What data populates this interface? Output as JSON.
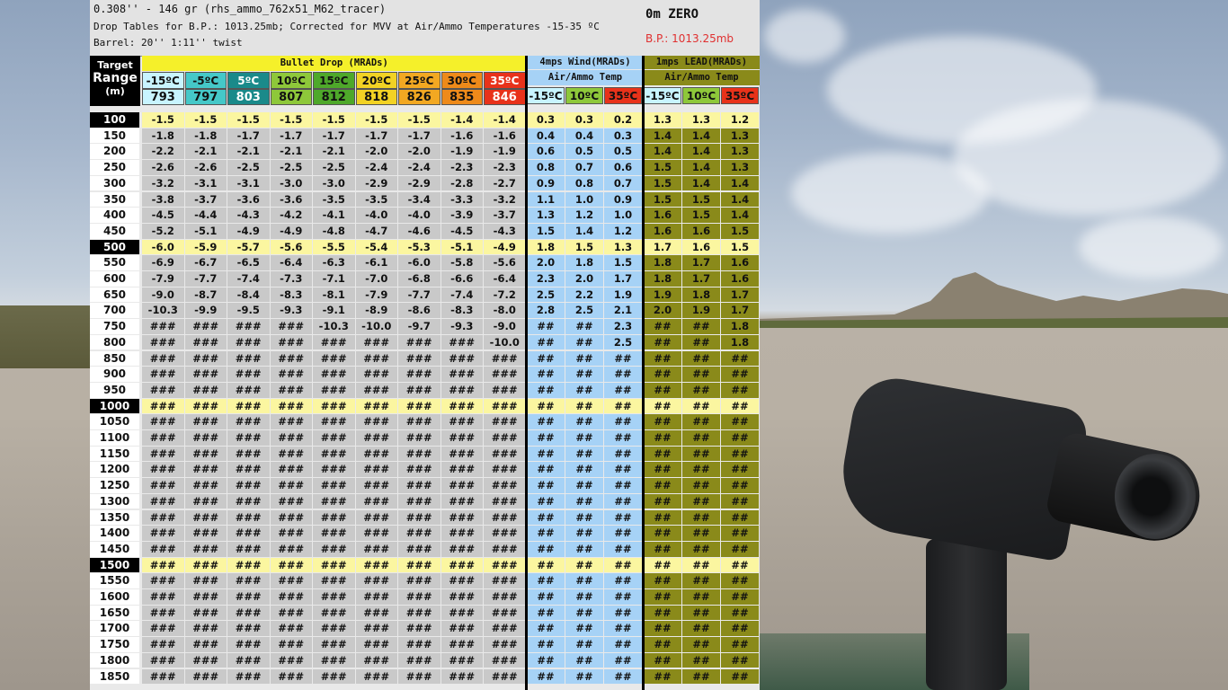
{
  "header": {
    "ammo_line": "0.308'' - 146 gr (rhs_ammo_762x51_M62_tracer)",
    "table_line": "Drop Tables for B.P.: 1013.25mb; Corrected for MVV at Air/Ammo Temperatures -15-35 ºC",
    "barrel_line": "Barrel: 20'' 1:11'' twist",
    "zero": "0m ZERO",
    "bp": "B.P.: 1013.25mb"
  },
  "target_header": {
    "line1": "Target",
    "line2": "Range",
    "line3": "(m)"
  },
  "drop_title": "Bullet Drop (MRADs)",
  "wind_title": "4mps Wind(MRADs)",
  "wind_sub": "Air/Ammo Temp",
  "lead_title": "1mps LEAD(MRADs)",
  "lead_sub": "Air/Ammo Temp",
  "temps": [
    {
      "t": "-15ºC",
      "v": "793",
      "bg": "#c8f4ff"
    },
    {
      "t": "-5ºC",
      "v": "797",
      "bg": "#45c8c8"
    },
    {
      "t": "5ºC",
      "v": "803",
      "bg": "#1a8a8a"
    },
    {
      "t": "10ºC",
      "v": "807",
      "bg": "#8ec83a"
    },
    {
      "t": "15ºC",
      "v": "812",
      "bg": "#4ea82a"
    },
    {
      "t": "20ºC",
      "v": "818",
      "bg": "#f2d224"
    },
    {
      "t": "25ºC",
      "v": "826",
      "bg": "#f2a822"
    },
    {
      "t": "30ºC",
      "v": "835",
      "bg": "#ee8a1a"
    },
    {
      "t": "35ºC",
      "v": "846",
      "bg": "#e8321a"
    }
  ],
  "sub_temps": [
    {
      "t": "-15ºC",
      "bg": "#c8f4ff"
    },
    {
      "t": "10ºC",
      "bg": "#8ec83a"
    },
    {
      "t": "35ºC",
      "bg": "#e8321a"
    }
  ],
  "colors": {
    "drop_cell": "#c9c9c9",
    "wind_cell": "#a6d2f6",
    "lead_cell": "#8a8a1a",
    "highlight_row": "#fbf6a0",
    "title_bar": "#f5f02a"
  },
  "rows": [
    {
      "r": "100",
      "hl": true,
      "d": [
        "-1.5",
        "-1.5",
        "-1.5",
        "-1.5",
        "-1.5",
        "-1.5",
        "-1.5",
        "-1.4",
        "-1.4"
      ],
      "w": [
        "0.3",
        "0.3",
        "0.2"
      ],
      "l": [
        "1.3",
        "1.3",
        "1.2"
      ]
    },
    {
      "r": "150",
      "d": [
        "-1.8",
        "-1.8",
        "-1.7",
        "-1.7",
        "-1.7",
        "-1.7",
        "-1.7",
        "-1.6",
        "-1.6"
      ],
      "w": [
        "0.4",
        "0.4",
        "0.3"
      ],
      "l": [
        "1.4",
        "1.4",
        "1.3"
      ]
    },
    {
      "r": "200",
      "d": [
        "-2.2",
        "-2.1",
        "-2.1",
        "-2.1",
        "-2.1",
        "-2.0",
        "-2.0",
        "-1.9",
        "-1.9"
      ],
      "w": [
        "0.6",
        "0.5",
        "0.5"
      ],
      "l": [
        "1.4",
        "1.4",
        "1.3"
      ]
    },
    {
      "r": "250",
      "d": [
        "-2.6",
        "-2.6",
        "-2.5",
        "-2.5",
        "-2.5",
        "-2.4",
        "-2.4",
        "-2.3",
        "-2.3"
      ],
      "w": [
        "0.8",
        "0.7",
        "0.6"
      ],
      "l": [
        "1.5",
        "1.4",
        "1.3"
      ]
    },
    {
      "r": "300",
      "d": [
        "-3.2",
        "-3.1",
        "-3.1",
        "-3.0",
        "-3.0",
        "-2.9",
        "-2.9",
        "-2.8",
        "-2.7"
      ],
      "w": [
        "0.9",
        "0.8",
        "0.7"
      ],
      "l": [
        "1.5",
        "1.4",
        "1.4"
      ]
    },
    {
      "r": "350",
      "d": [
        "-3.8",
        "-3.7",
        "-3.6",
        "-3.6",
        "-3.5",
        "-3.5",
        "-3.4",
        "-3.3",
        "-3.2"
      ],
      "w": [
        "1.1",
        "1.0",
        "0.9"
      ],
      "l": [
        "1.5",
        "1.5",
        "1.4"
      ]
    },
    {
      "r": "400",
      "d": [
        "-4.5",
        "-4.4",
        "-4.3",
        "-4.2",
        "-4.1",
        "-4.0",
        "-4.0",
        "-3.9",
        "-3.7"
      ],
      "w": [
        "1.3",
        "1.2",
        "1.0"
      ],
      "l": [
        "1.6",
        "1.5",
        "1.4"
      ]
    },
    {
      "r": "450",
      "d": [
        "-5.2",
        "-5.1",
        "-4.9",
        "-4.9",
        "-4.8",
        "-4.7",
        "-4.6",
        "-4.5",
        "-4.3"
      ],
      "w": [
        "1.5",
        "1.4",
        "1.2"
      ],
      "l": [
        "1.6",
        "1.6",
        "1.5"
      ]
    },
    {
      "r": "500",
      "hl": true,
      "d": [
        "-6.0",
        "-5.9",
        "-5.7",
        "-5.6",
        "-5.5",
        "-5.4",
        "-5.3",
        "-5.1",
        "-4.9"
      ],
      "w": [
        "1.8",
        "1.5",
        "1.3"
      ],
      "l": [
        "1.7",
        "1.6",
        "1.5"
      ]
    },
    {
      "r": "550",
      "d": [
        "-6.9",
        "-6.7",
        "-6.5",
        "-6.4",
        "-6.3",
        "-6.1",
        "-6.0",
        "-5.8",
        "-5.6"
      ],
      "w": [
        "2.0",
        "1.8",
        "1.5"
      ],
      "l": [
        "1.8",
        "1.7",
        "1.6"
      ]
    },
    {
      "r": "600",
      "d": [
        "-7.9",
        "-7.7",
        "-7.4",
        "-7.3",
        "-7.1",
        "-7.0",
        "-6.8",
        "-6.6",
        "-6.4"
      ],
      "w": [
        "2.3",
        "2.0",
        "1.7"
      ],
      "l": [
        "1.8",
        "1.7",
        "1.6"
      ]
    },
    {
      "r": "650",
      "d": [
        "-9.0",
        "-8.7",
        "-8.4",
        "-8.3",
        "-8.1",
        "-7.9",
        "-7.7",
        "-7.4",
        "-7.2"
      ],
      "w": [
        "2.5",
        "2.2",
        "1.9"
      ],
      "l": [
        "1.9",
        "1.8",
        "1.7"
      ]
    },
    {
      "r": "700",
      "d": [
        "-10.3",
        "-9.9",
        "-9.5",
        "-9.3",
        "-9.1",
        "-8.9",
        "-8.6",
        "-8.3",
        "-8.0"
      ],
      "w": [
        "2.8",
        "2.5",
        "2.1"
      ],
      "l": [
        "2.0",
        "1.9",
        "1.7"
      ]
    },
    {
      "r": "750",
      "d": [
        "###",
        "###",
        "###",
        "###",
        "-10.3",
        "-10.0",
        "-9.7",
        "-9.3",
        "-9.0"
      ],
      "w": [
        "##",
        "##",
        "2.3"
      ],
      "l": [
        "##",
        "##",
        "1.8"
      ]
    },
    {
      "r": "800",
      "d": [
        "###",
        "###",
        "###",
        "###",
        "###",
        "###",
        "###",
        "###",
        "-10.0"
      ],
      "w": [
        "##",
        "##",
        "2.5"
      ],
      "l": [
        "##",
        "##",
        "1.8"
      ]
    },
    {
      "r": "850",
      "d": [
        "###",
        "###",
        "###",
        "###",
        "###",
        "###",
        "###",
        "###",
        "###"
      ],
      "w": [
        "##",
        "##",
        "##"
      ],
      "l": [
        "##",
        "##",
        "##"
      ]
    },
    {
      "r": "900",
      "d": [
        "###",
        "###",
        "###",
        "###",
        "###",
        "###",
        "###",
        "###",
        "###"
      ],
      "w": [
        "##",
        "##",
        "##"
      ],
      "l": [
        "##",
        "##",
        "##"
      ]
    },
    {
      "r": "950",
      "d": [
        "###",
        "###",
        "###",
        "###",
        "###",
        "###",
        "###",
        "###",
        "###"
      ],
      "w": [
        "##",
        "##",
        "##"
      ],
      "l": [
        "##",
        "##",
        "##"
      ]
    },
    {
      "r": "1000",
      "hl": true,
      "d": [
        "###",
        "###",
        "###",
        "###",
        "###",
        "###",
        "###",
        "###",
        "###"
      ],
      "w": [
        "##",
        "##",
        "##"
      ],
      "l": [
        "##",
        "##",
        "##"
      ]
    },
    {
      "r": "1050",
      "d": [
        "###",
        "###",
        "###",
        "###",
        "###",
        "###",
        "###",
        "###",
        "###"
      ],
      "w": [
        "##",
        "##",
        "##"
      ],
      "l": [
        "##",
        "##",
        "##"
      ]
    },
    {
      "r": "1100",
      "d": [
        "###",
        "###",
        "###",
        "###",
        "###",
        "###",
        "###",
        "###",
        "###"
      ],
      "w": [
        "##",
        "##",
        "##"
      ],
      "l": [
        "##",
        "##",
        "##"
      ]
    },
    {
      "r": "1150",
      "d": [
        "###",
        "###",
        "###",
        "###",
        "###",
        "###",
        "###",
        "###",
        "###"
      ],
      "w": [
        "##",
        "##",
        "##"
      ],
      "l": [
        "##",
        "##",
        "##"
      ]
    },
    {
      "r": "1200",
      "d": [
        "###",
        "###",
        "###",
        "###",
        "###",
        "###",
        "###",
        "###",
        "###"
      ],
      "w": [
        "##",
        "##",
        "##"
      ],
      "l": [
        "##",
        "##",
        "##"
      ]
    },
    {
      "r": "1250",
      "d": [
        "###",
        "###",
        "###",
        "###",
        "###",
        "###",
        "###",
        "###",
        "###"
      ],
      "w": [
        "##",
        "##",
        "##"
      ],
      "l": [
        "##",
        "##",
        "##"
      ]
    },
    {
      "r": "1300",
      "d": [
        "###",
        "###",
        "###",
        "###",
        "###",
        "###",
        "###",
        "###",
        "###"
      ],
      "w": [
        "##",
        "##",
        "##"
      ],
      "l": [
        "##",
        "##",
        "##"
      ]
    },
    {
      "r": "1350",
      "d": [
        "###",
        "###",
        "###",
        "###",
        "###",
        "###",
        "###",
        "###",
        "###"
      ],
      "w": [
        "##",
        "##",
        "##"
      ],
      "l": [
        "##",
        "##",
        "##"
      ]
    },
    {
      "r": "1400",
      "d": [
        "###",
        "###",
        "###",
        "###",
        "###",
        "###",
        "###",
        "###",
        "###"
      ],
      "w": [
        "##",
        "##",
        "##"
      ],
      "l": [
        "##",
        "##",
        "##"
      ]
    },
    {
      "r": "1450",
      "d": [
        "###",
        "###",
        "###",
        "###",
        "###",
        "###",
        "###",
        "###",
        "###"
      ],
      "w": [
        "##",
        "##",
        "##"
      ],
      "l": [
        "##",
        "##",
        "##"
      ]
    },
    {
      "r": "1500",
      "hl": true,
      "d": [
        "###",
        "###",
        "###",
        "###",
        "###",
        "###",
        "###",
        "###",
        "###"
      ],
      "w": [
        "##",
        "##",
        "##"
      ],
      "l": [
        "##",
        "##",
        "##"
      ]
    },
    {
      "r": "1550",
      "d": [
        "###",
        "###",
        "###",
        "###",
        "###",
        "###",
        "###",
        "###",
        "###"
      ],
      "w": [
        "##",
        "##",
        "##"
      ],
      "l": [
        "##",
        "##",
        "##"
      ]
    },
    {
      "r": "1600",
      "d": [
        "###",
        "###",
        "###",
        "###",
        "###",
        "###",
        "###",
        "###",
        "###"
      ],
      "w": [
        "##",
        "##",
        "##"
      ],
      "l": [
        "##",
        "##",
        "##"
      ]
    },
    {
      "r": "1650",
      "d": [
        "###",
        "###",
        "###",
        "###",
        "###",
        "###",
        "###",
        "###",
        "###"
      ],
      "w": [
        "##",
        "##",
        "##"
      ],
      "l": [
        "##",
        "##",
        "##"
      ]
    },
    {
      "r": "1700",
      "d": [
        "###",
        "###",
        "###",
        "###",
        "###",
        "###",
        "###",
        "###",
        "###"
      ],
      "w": [
        "##",
        "##",
        "##"
      ],
      "l": [
        "##",
        "##",
        "##"
      ]
    },
    {
      "r": "1750",
      "d": [
        "###",
        "###",
        "###",
        "###",
        "###",
        "###",
        "###",
        "###",
        "###"
      ],
      "w": [
        "##",
        "##",
        "##"
      ],
      "l": [
        "##",
        "##",
        "##"
      ]
    },
    {
      "r": "1800",
      "d": [
        "###",
        "###",
        "###",
        "###",
        "###",
        "###",
        "###",
        "###",
        "###"
      ],
      "w": [
        "##",
        "##",
        "##"
      ],
      "l": [
        "##",
        "##",
        "##"
      ]
    },
    {
      "r": "1850",
      "d": [
        "###",
        "###",
        "###",
        "###",
        "###",
        "###",
        "###",
        "###",
        "###"
      ],
      "w": [
        "##",
        "##",
        "##"
      ],
      "l": [
        "##",
        "##",
        "##"
      ]
    }
  ]
}
